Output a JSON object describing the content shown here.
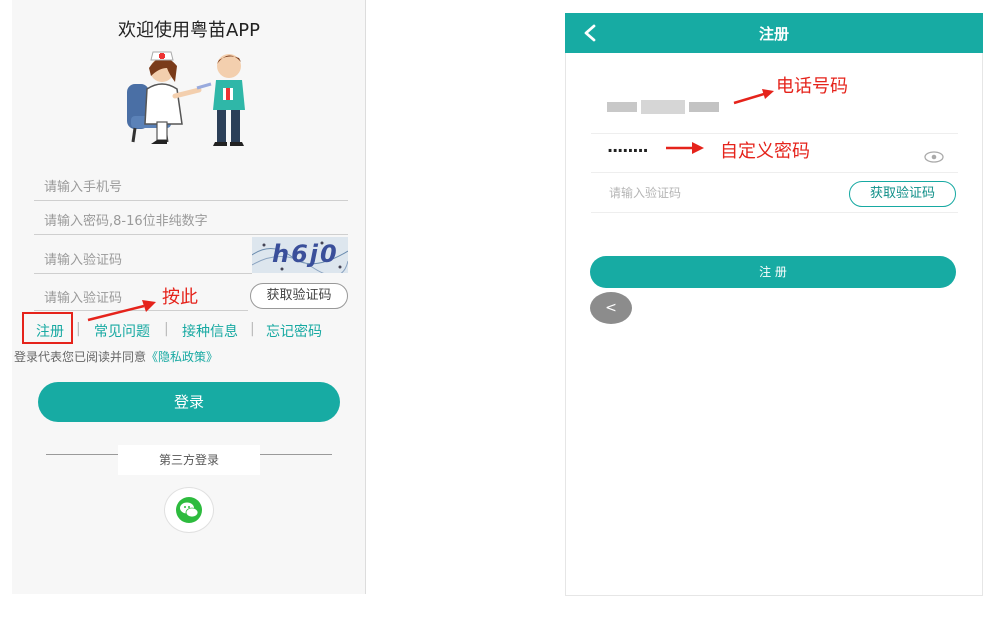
{
  "left": {
    "title": "欢迎使用粤苗APP",
    "phone_placeholder": "请输入手机号",
    "password_placeholder": "请输入密码,8-16位非纯数字",
    "captcha_placeholder": "请输入验证码",
    "captcha_text": "h6j0",
    "sms_placeholder": "请输入验证码",
    "get_code_label": "获取验证码",
    "links": {
      "register": "注册",
      "faq": "常见问题",
      "vaccination_info": "接种信息",
      "forgot_password": "忘记密码",
      "separator": "|"
    },
    "agreement_prefix": "登录代表您已阅读并同意",
    "privacy_link": "《隐私政策》",
    "login_label": "登录",
    "third_party_label": "第三方登录"
  },
  "right": {
    "header_title": "注册",
    "password_dots": "········",
    "verify_placeholder": "请输入验证码",
    "get_code_label": "获取验证码",
    "register_label": "注 册",
    "back_bubble": "<"
  },
  "annotations": {
    "press_here": "按此",
    "phone_number": "电话号码",
    "custom_password": "自定义密码"
  },
  "colors": {
    "teal": "#17aba3",
    "annotation_red": "#e5231b"
  }
}
